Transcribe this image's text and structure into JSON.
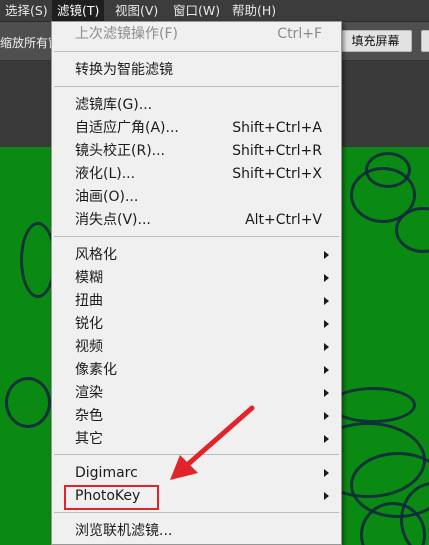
{
  "menubar": {
    "items": [
      {
        "label": "选择(S)"
      },
      {
        "label": "滤镜(T)"
      },
      {
        "label": "视图(V)"
      },
      {
        "label": "窗口(W)"
      },
      {
        "label": "帮助(H)"
      }
    ]
  },
  "options_bar": {
    "partial_text": "缩放所有窗",
    "button_partial": "寸",
    "fill_screen_button": "填充屏幕"
  },
  "filter_menu": {
    "last_filter": {
      "label": "上次滤镜操作(F)",
      "shortcut": "Ctrl+F"
    },
    "convert_smart": {
      "label": "转换为智能滤镜"
    },
    "gallery": {
      "label": "滤镜库(G)..."
    },
    "adaptive_wide_angle": {
      "label": "自适应广角(A)...",
      "shortcut": "Shift+Ctrl+A"
    },
    "lens_correction": {
      "label": "镜头校正(R)...",
      "shortcut": "Shift+Ctrl+R"
    },
    "liquify": {
      "label": "液化(L)...",
      "shortcut": "Shift+Ctrl+X"
    },
    "oil_paint": {
      "label": "油画(O)..."
    },
    "vanishing_point": {
      "label": "消失点(V)...",
      "shortcut": "Alt+Ctrl+V"
    },
    "submenus": [
      {
        "label": "风格化"
      },
      {
        "label": "模糊"
      },
      {
        "label": "扭曲"
      },
      {
        "label": "锐化"
      },
      {
        "label": "视频"
      },
      {
        "label": "像素化"
      },
      {
        "label": "渲染"
      },
      {
        "label": "杂色"
      },
      {
        "label": "其它"
      }
    ],
    "digimarc": {
      "label": "Digimarc"
    },
    "photokey": {
      "label": "PhotoKey"
    },
    "browse_online": {
      "label": "浏览联机滤镜..."
    }
  },
  "colors": {
    "menu_bg": "#f0f0f0",
    "canvas_green": "#0b8a13",
    "annotation_red": "#e0242a"
  }
}
